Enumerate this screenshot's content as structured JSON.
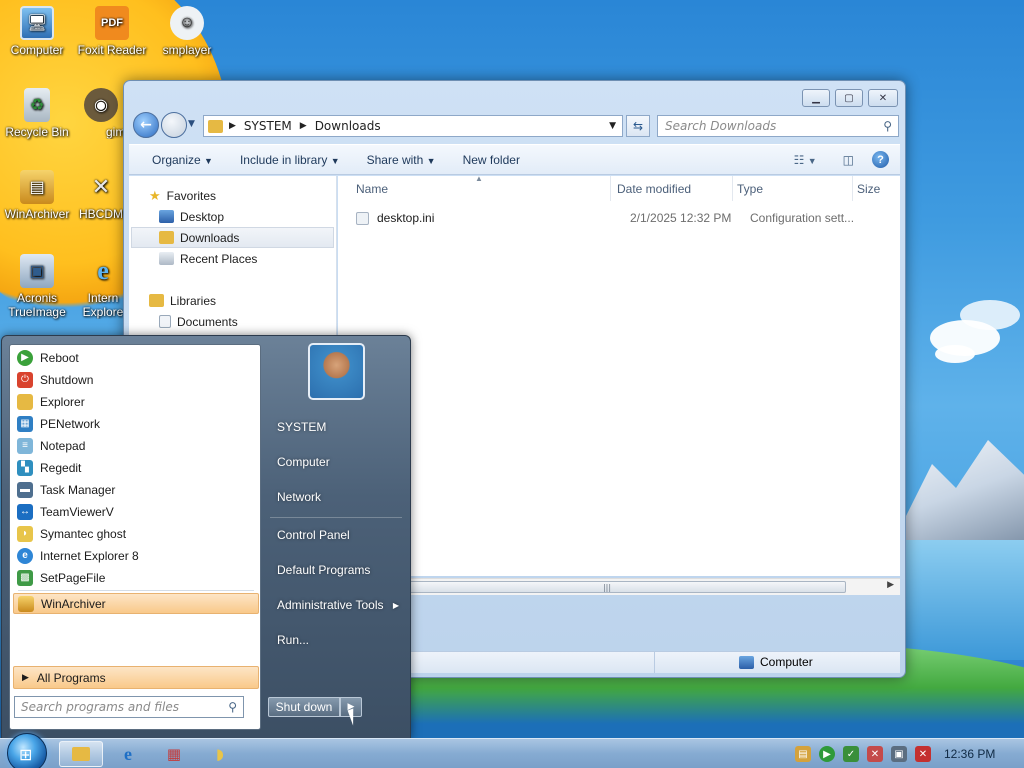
{
  "desktop": {
    "icons": [
      {
        "label": "Computer"
      },
      {
        "label": "Foxit Reader"
      },
      {
        "label": "smplayer"
      },
      {
        "label": "Recycle Bin"
      },
      {
        "label": "gimp"
      },
      {
        "label": "WinArchiver"
      },
      {
        "label": "HBCDM"
      },
      {
        "label": "Acronis TrueImage"
      },
      {
        "label": "Intern Explore"
      }
    ]
  },
  "explorer": {
    "address": {
      "crumb1": "SYSTEM",
      "crumb2": "Downloads"
    },
    "search_placeholder": "Search Downloads",
    "toolbar": {
      "organize": "Organize",
      "include": "Include in library",
      "share": "Share with",
      "new_folder": "New folder"
    },
    "nav": {
      "favorites": "Favorites",
      "desktop": "Desktop",
      "downloads": "Downloads",
      "recent": "Recent Places",
      "libraries": "Libraries",
      "documents": "Documents"
    },
    "columns": {
      "name": "Name",
      "date": "Date modified",
      "type": "Type",
      "size": "Size"
    },
    "files": [
      {
        "name": "desktop.ini",
        "date": "2/1/2025 12:32 PM",
        "type": "Configuration sett..."
      }
    ],
    "status": {
      "location": "Computer"
    }
  },
  "start_menu": {
    "programs": [
      {
        "label": "Reboot",
        "icon": "reboot-icon",
        "color": "#3aa13a"
      },
      {
        "label": "Shutdown",
        "icon": "power-icon",
        "color": "#d9432e"
      },
      {
        "label": "Explorer",
        "icon": "folder-icon",
        "color": "#e6b943"
      },
      {
        "label": "PENetwork",
        "icon": "network-icon",
        "color": "#2f7fc4"
      },
      {
        "label": "Notepad",
        "icon": "notepad-icon",
        "color": "#7fb6d9"
      },
      {
        "label": "Regedit",
        "icon": "regedit-icon",
        "color": "#2f8fbf"
      },
      {
        "label": "Task Manager",
        "icon": "task-manager-icon",
        "color": "#4f6f8f"
      },
      {
        "label": "TeamViewerV",
        "icon": "teamviewer-icon",
        "color": "#1b6ec2"
      },
      {
        "label": "Symantec ghost",
        "icon": "ghost-icon",
        "color": "#e8c54a"
      },
      {
        "label": "Internet Explorer 8",
        "icon": "ie-icon",
        "color": "#2e86d6"
      },
      {
        "label": "SetPageFile",
        "icon": "pagefile-icon",
        "color": "#3f9a46"
      }
    ],
    "pinned": {
      "label": "WinArchiver"
    },
    "all_programs": "All Programs",
    "search_placeholder": "Search programs and files",
    "right": {
      "user": "SYSTEM",
      "computer": "Computer",
      "network": "Network",
      "control_panel": "Control Panel",
      "default_programs": "Default Programs",
      "admin_tools": "Administrative Tools",
      "run": "Run..."
    },
    "shutdown_label": "Shut down"
  },
  "taskbar": {
    "clock": "12:36 PM"
  }
}
